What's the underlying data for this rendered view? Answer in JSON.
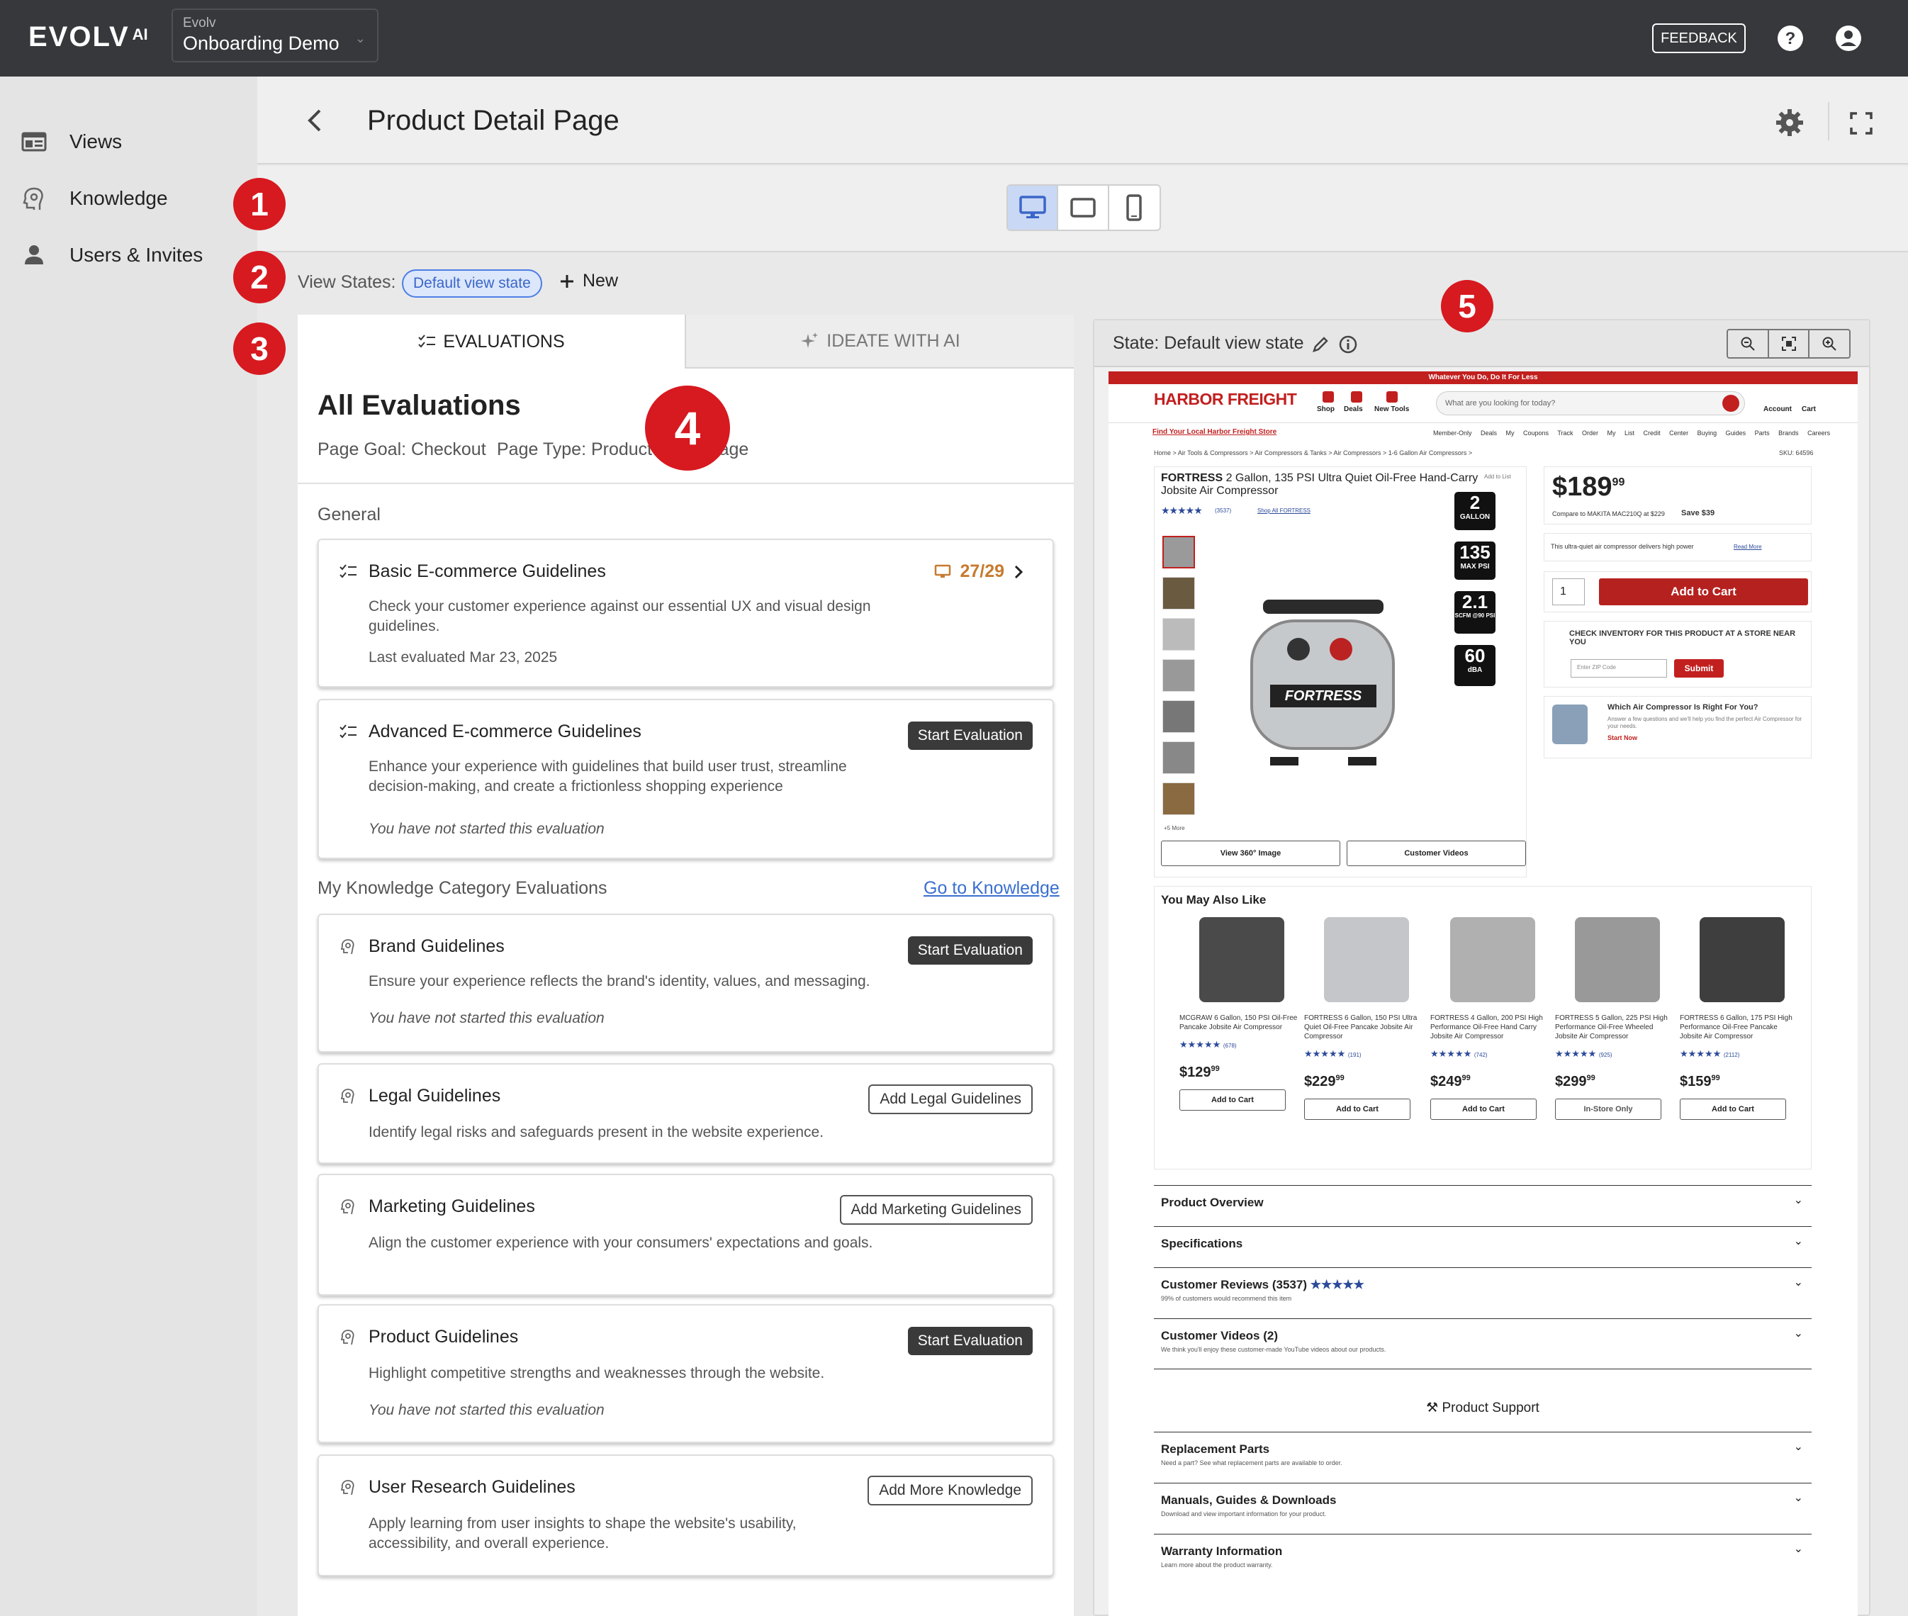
{
  "topbar": {
    "logo": "EVOLV",
    "logo_sup": "AI",
    "project_label": "Evolv",
    "project_name": "Onboarding Demo",
    "feedback_label": "FEEDBACK"
  },
  "sidebar": {
    "items": [
      {
        "label": "Views",
        "icon": "views-icon"
      },
      {
        "label": "Knowledge",
        "icon": "knowledge-icon"
      },
      {
        "label": "Users & Invites",
        "icon": "user-icon"
      }
    ]
  },
  "header": {
    "title": "Product Detail Page"
  },
  "devices": [
    "desktop",
    "tablet",
    "mobile"
  ],
  "active_device": "desktop",
  "badges": [
    "1",
    "2",
    "3",
    "4",
    "5"
  ],
  "view_states": {
    "label": "View States:",
    "chip": "Default view state",
    "new_label": "New"
  },
  "tabs": {
    "evaluations": "EVALUATIONS",
    "ideate": "IDEATE WITH AI"
  },
  "evaluations": {
    "title": "All Evaluations",
    "page_goal": "Page Goal: Checkout",
    "page_type": "Page Type: Product Detail Page",
    "general_label": "General",
    "knowledge_label": "My Knowledge Category Evaluations",
    "go_to_knowledge": "Go to Knowledge",
    "cards": [
      {
        "title": "Basic E-commerce Guidelines",
        "desc": "Check your customer experience against our essential UX and visual design guidelines.",
        "meta": "Last evaluated Mar 23, 2025",
        "score": "27/29"
      },
      {
        "title": "Advanced E-commerce Guidelines",
        "desc": "Enhance your experience with guidelines that build user trust, streamline decision-making, and create a frictionless shopping experience",
        "meta": "You have not started this evaluation",
        "button": "Start Evaluation"
      },
      {
        "title": "Brand Guidelines",
        "desc": "Ensure your experience reflects the brand's identity, values, and messaging.",
        "meta": "You have not started this evaluation",
        "button": "Start Evaluation"
      },
      {
        "title": "Legal Guidelines",
        "desc": "Identify legal risks and safeguards present in the website experience.",
        "button": "Add Legal Guidelines"
      },
      {
        "title": "Marketing Guidelines",
        "desc": "Align the customer experience with your consumers' expectations and goals.",
        "button": "Add Marketing Guidelines"
      },
      {
        "title": "Product Guidelines",
        "desc": "Highlight competitive strengths and weaknesses through the website.",
        "meta": "You have not started this evaluation",
        "button": "Start Evaluation"
      },
      {
        "title": "User Research Guidelines",
        "desc": "Apply learning from user insights to shape the website's usability, accessibility, and overall experience.",
        "button": "Add More Knowledge"
      }
    ]
  },
  "preview": {
    "state_label": "State: Default view state",
    "site": {
      "promo": "Whatever You Do, Do It For Less",
      "logo": "HARBOR FREIGHT",
      "nav": [
        "Shop",
        "Deals",
        "New Tools"
      ],
      "search_placeholder": "What are you looking for today?",
      "account": "Account",
      "cart": "Cart",
      "find_store": "Find Your Local Harbor Freight Store",
      "top_links": "Member-Only Deals My Coupons Track Order My List Credit Center Buying Guides Parts Brands Careers",
      "breadcrumb": "Home > Air Tools & Compressors > Air Compressors & Tanks > Air Compressors > 1-6 Gallon Air Compressors >",
      "sku": "SKU: 64596",
      "product_brand": "FORTRESS",
      "product_title": "2 Gallon, 135 PSI Ultra Quiet Oil-Free Hand-Carry Jobsite Air Compressor",
      "add_to_list": "Add to List",
      "review_count": "(3537)",
      "shop_all": "Shop All FORTRESS",
      "more_thumbs": "+5 More",
      "specs": [
        {
          "value": "2",
          "unit": "GALLON"
        },
        {
          "value": "135",
          "unit": "MAX PSI"
        },
        {
          "value": "2.1",
          "unit": "SCFM @90 PSI"
        },
        {
          "value": "60",
          "unit": "dBA"
        }
      ],
      "view360": "View 360° Image",
      "customer_videos": "Customer Videos",
      "price_dollars": "189",
      "price_cents": "99",
      "compare": "Compare to MAKITA MAC210Q at $229",
      "save": "Save $39",
      "tagline": "This ultra-quiet air compressor delivers high power",
      "read_more": "Read More",
      "qty": "1",
      "add_to_cart": "Add to Cart",
      "inventory_title": "CHECK INVENTORY FOR THIS PRODUCT AT A STORE NEAR YOU",
      "zip_placeholder": "Enter ZIP Code",
      "submit": "Submit",
      "quiz_title": "Which Air Compressor Is Right For You?",
      "quiz_desc": "Answer a few questions and we'll help you find the perfect Air Compressor for your needs.",
      "quiz_cta": "Start Now",
      "you_may_also_like": "You May Also Like",
      "recs": [
        {
          "name": "MCGRAW 6 Gallon, 150 PSI Oil-Free Pancake Jobsite Air Compressor",
          "reviews": "(678)",
          "dollars": "129",
          "cents": "99",
          "button": "Add to Cart"
        },
        {
          "name": "FORTRESS 6 Gallon, 150 PSI Ultra Quiet Oil-Free Pancake Jobsite Air Compressor",
          "reviews": "(191)",
          "dollars": "229",
          "cents": "99",
          "button": "Add to Cart"
        },
        {
          "name": "FORTRESS 4 Gallon, 200 PSI High Performance Oil-Free Hand Carry Jobsite Air Compressor",
          "reviews": "(742)",
          "dollars": "249",
          "cents": "99",
          "button": "Add to Cart"
        },
        {
          "name": "FORTRESS 5 Gallon, 225 PSI High Performance Oil-Free Wheeled Jobsite Air Compressor",
          "reviews": "(925)",
          "dollars": "299",
          "cents": "99",
          "button": "In-Store Only"
        },
        {
          "name": "FORTRESS 6 Gallon, 175 PSI High Performance Oil-Free Pancake Jobsite Air Compressor",
          "reviews": "(2112)",
          "dollars": "159",
          "cents": "99",
          "button": "Add to Cart"
        }
      ],
      "accordions": [
        {
          "title": "Product Overview",
          "sub": ""
        },
        {
          "title": "Specifications",
          "sub": ""
        },
        {
          "title": "Customer Reviews (3537)",
          "sub": "99% of customers would recommend this item"
        },
        {
          "title": "Customer Videos (2)",
          "sub": "We think you'll enjoy these customer-made YouTube videos about our products."
        }
      ],
      "support_title": "Product Support",
      "support_accordions": [
        {
          "title": "Replacement Parts",
          "sub": "Need a part? See what replacement parts are available to order."
        },
        {
          "title": "Manuals, Guides & Downloads",
          "sub": "Download and view important information for your product."
        },
        {
          "title": "Warranty Information",
          "sub": "Learn more about the product warranty."
        }
      ]
    }
  },
  "colors": {
    "topbar": "#36383b",
    "badge": "#d71920",
    "score": "#c77b30",
    "link": "#3a6fd0",
    "hf_red": "#c21f1f"
  }
}
